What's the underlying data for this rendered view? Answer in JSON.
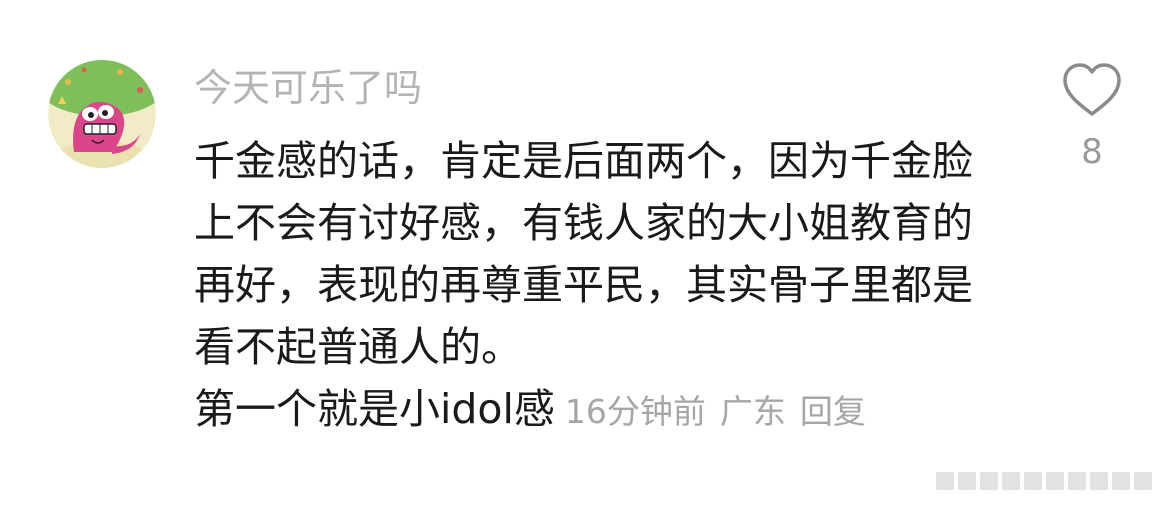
{
  "comment": {
    "username": "今天可乐了吗",
    "text_lines": [
      "千金感的话，肯定是后面两个，因为千金脸",
      "上不会有讨好感，有钱人家的大小姐教育的",
      "再好，表现的再尊重平民，其实骨子里都是",
      "看不起普通人的。",
      "第一个就是小idol感"
    ],
    "time": "16分钟前",
    "location": "广东",
    "reply_label": "回复",
    "like_count": "8",
    "like_icon": "heart-outline-icon",
    "avatar_icon": "cartoon-pink-dinosaur-avatar"
  },
  "colors": {
    "username": "#b4b4b4",
    "text": "#1a1a1a",
    "meta": "#a6a6a6",
    "icon": "#8c8c8c"
  }
}
